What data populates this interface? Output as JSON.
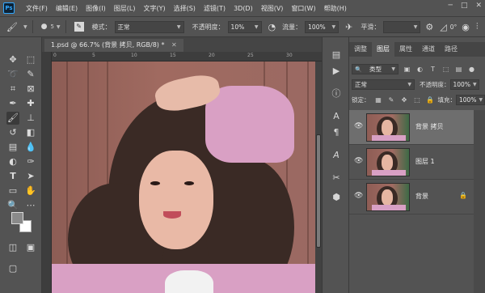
{
  "menu": {
    "logo": "Ps",
    "items": [
      "文件(F)",
      "编辑(E)",
      "图像(I)",
      "图层(L)",
      "文字(Y)",
      "选择(S)",
      "滤镜(T)",
      "3D(D)",
      "视图(V)",
      "窗口(W)",
      "帮助(H)"
    ],
    "window_controls": [
      "─",
      "□",
      "✕"
    ]
  },
  "options": {
    "brush_size": "5",
    "mode_label": "模式：",
    "mode_value": "正常",
    "opacity_label": "不透明度：",
    "opacity_value": "10%",
    "flow_label": "流量：",
    "flow_value": "100%",
    "smooth_label": "平滑：",
    "angle_value": "0°"
  },
  "document": {
    "tab_title": "1.psd @ 66.7% (背景 拷贝, RGB/8) *",
    "ruler_labels": [
      "0",
      "5",
      "10",
      "15",
      "20",
      "25",
      "30"
    ]
  },
  "panels": {
    "tabs": [
      "调整",
      "图层",
      "属性",
      "通道",
      "路径"
    ],
    "active_tab": "图层",
    "filter_kind": "类型",
    "blend_mode": "正常",
    "opacity_label": "不透明度：",
    "opacity_value": "100%",
    "lock_label": "锁定：",
    "fill_label": "填充：",
    "fill_value": "100%",
    "layers": [
      {
        "name": "背景 拷贝",
        "selected": true,
        "locked": false
      },
      {
        "name": "图层 1",
        "selected": false,
        "locked": false
      },
      {
        "name": "背景",
        "selected": false,
        "locked": true
      }
    ]
  },
  "icons": {
    "eye": "eye-icon",
    "lock": "lock-icon"
  }
}
